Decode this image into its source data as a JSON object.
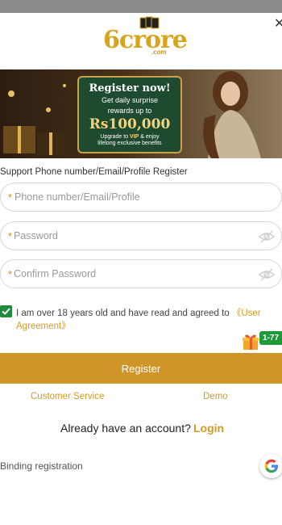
{
  "brand": {
    "logo_text": "6crore",
    "logo_sub": ".com"
  },
  "banner": {
    "headline": "Register now!",
    "line1": "Get daily surprise",
    "line2": "rewards up to",
    "amount": "Rs100,000",
    "foot1_pre": "Upgrade to ",
    "foot1_vip": "VIP",
    "foot1_post": " & enjoy",
    "foot2": "lifelong exclusive benefits"
  },
  "form": {
    "label": "Support Phone number/Email/Profile Register",
    "fields": [
      {
        "star": "*",
        "placeholder": "Phone number/Email/Profile"
      },
      {
        "star": "*",
        "placeholder": "Password"
      },
      {
        "star": "*",
        "placeholder": "Confirm Password"
      }
    ],
    "agreement_text": "I am over 18 years old and have read and agreed to ",
    "agreement_link": "《User Agreement》",
    "gift_badge": "1-77",
    "register_label": "Register"
  },
  "links": {
    "customer_service": "Customer Service",
    "demo": "Demo"
  },
  "account": {
    "prompt": "Already have an account?",
    "login": "Login"
  },
  "binding": {
    "label": "Binding registration"
  },
  "colors": {
    "accent": "#cf9528",
    "check": "#1e8a3c",
    "badge": "#1e9a3a"
  }
}
